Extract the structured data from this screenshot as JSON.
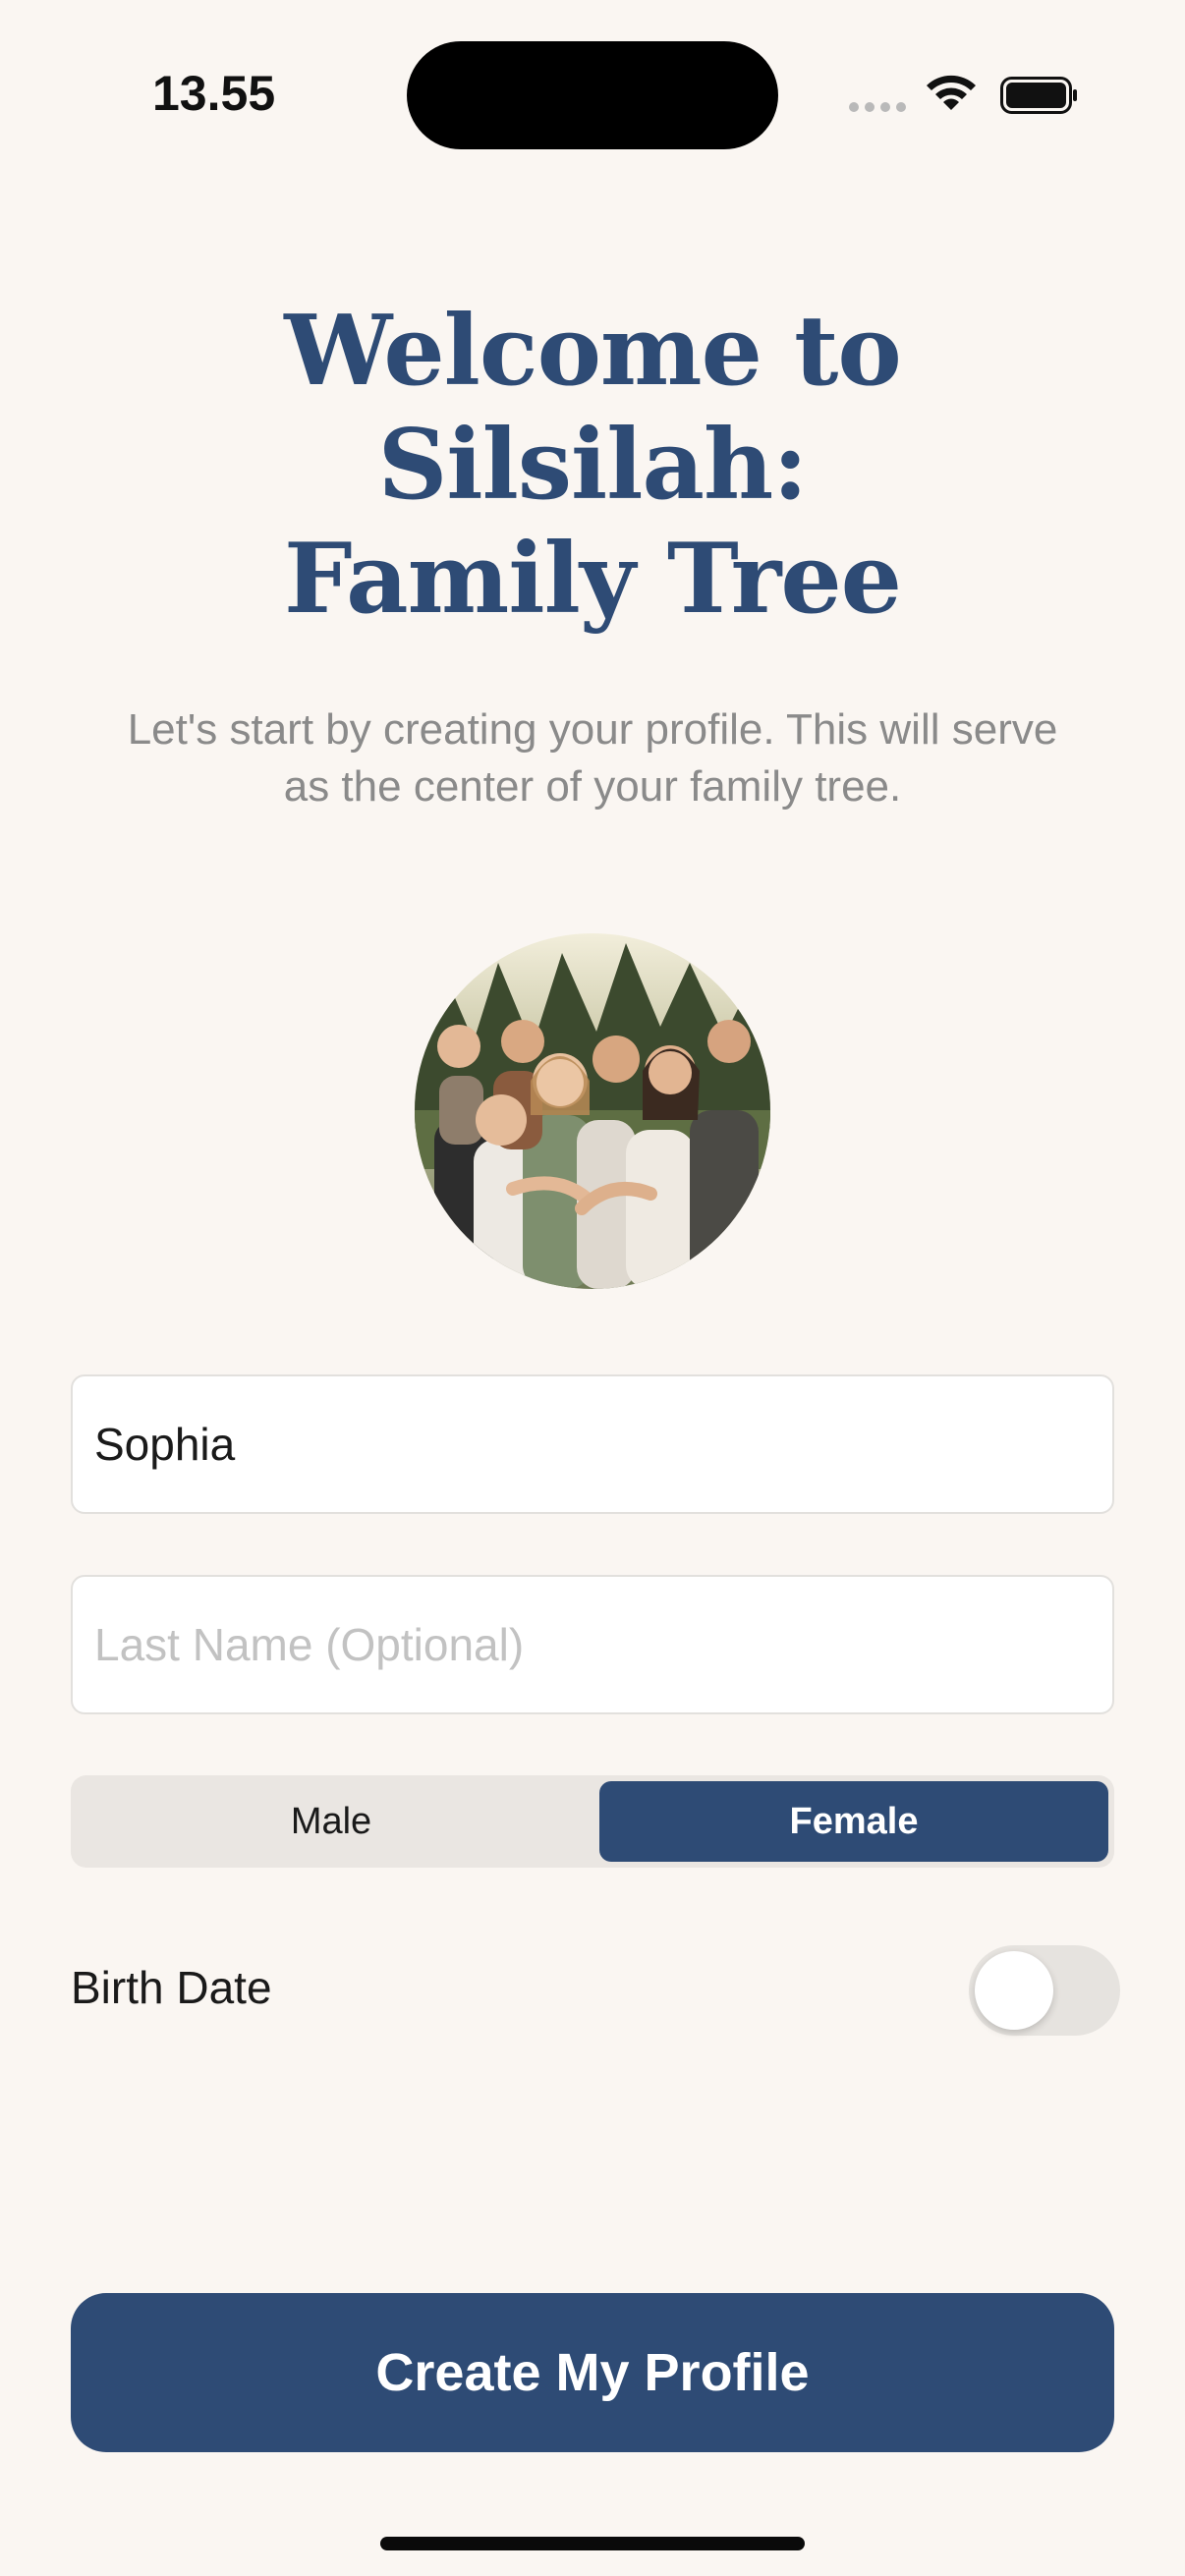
{
  "status_bar": {
    "time": "13.55"
  },
  "onboarding": {
    "title_lines": [
      "Welcome to",
      "Silsilah:",
      "Family Tree"
    ],
    "subtitle": "Let's start by creating your profile. This will serve as the center of your family tree."
  },
  "profile_photo": {
    "icon": "family-photo"
  },
  "form": {
    "first_name_value": "Sophia",
    "last_name_placeholder": "Last Name (Optional)",
    "gender_options": [
      "Male",
      "Female"
    ],
    "gender_selected": "Female",
    "birth_date_label": "Birth Date",
    "birth_date_enabled": false
  },
  "actions": {
    "create_label": "Create My Profile"
  },
  "colors": {
    "background": "#FAF6F2",
    "brand": "#2E4B75",
    "subtitle": "#8A8A8A"
  }
}
